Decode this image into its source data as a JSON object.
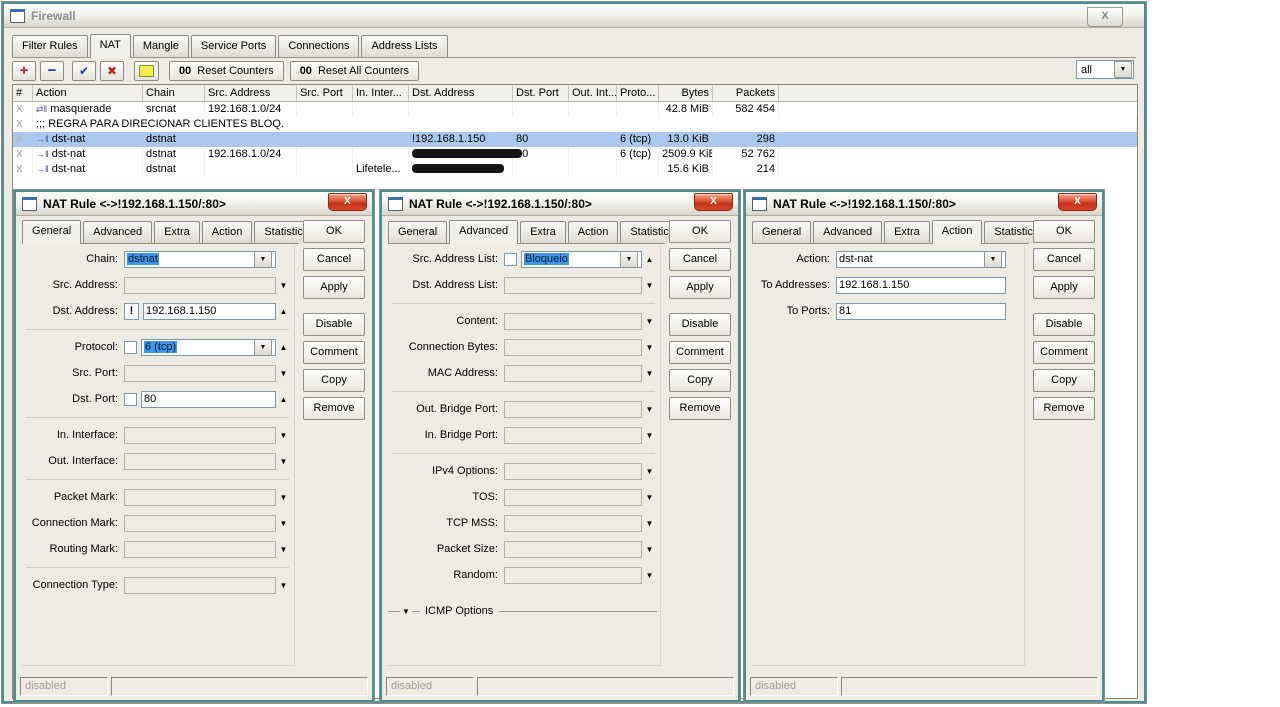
{
  "colors": {
    "selection_bg": "#3e95e5",
    "selected_row_bg": "#aac8ee",
    "frame_teal": "#4a8f8d",
    "close_button_red": "#d8472b"
  },
  "window": {
    "title": "Firewall",
    "close_glyph": "X",
    "tabs": [
      {
        "label": "Filter Rules"
      },
      {
        "label": "NAT"
      },
      {
        "label": "Mangle"
      },
      {
        "label": "Service Ports"
      },
      {
        "label": "Connections"
      },
      {
        "label": "Address Lists"
      }
    ],
    "active_tab": "NAT",
    "toolbar": {
      "icons": {
        "add": "+",
        "remove": "−",
        "enable": "✔",
        "disable": "✖",
        "comment": "note"
      },
      "reset_counters_prefix": "00",
      "reset_counters_label": "Reset Counters",
      "reset_all_counters_prefix": "00",
      "reset_all_counters_label": "Reset All Counters",
      "filter_value": "all"
    },
    "table": {
      "columns": [
        "#",
        "Action",
        "Chain",
        "Src. Address",
        "Src. Port",
        "In. Inter...",
        "Dst. Address",
        "Dst. Port",
        "Out. Int...",
        "Proto...",
        "Bytes",
        "Packets"
      ],
      "rows": [
        {
          "flag": "X",
          "action": "masquerade",
          "chain": "srcnat",
          "src_address": "192.168.1.0/24",
          "bytes": "42.8 MiB",
          "packets": "582 454"
        },
        {
          "flag": "X",
          "comment": ";;; REGRA PARA DIRECIONAR CLIENTES BLOQ."
        },
        {
          "flag": "X",
          "action": "dst-nat",
          "chain": "dstnat",
          "dst_address": "!192.168.1.150",
          "dst_port": "80",
          "protocol": "6 (tcp)",
          "bytes": "13.0 KiB",
          "packets": "298",
          "state": "selected"
        },
        {
          "flag": "X",
          "action": "dst-nat",
          "chain": "dstnat",
          "src_address": "192.168.1.0/24",
          "dst_address": "[redacted]",
          "dst_port": "80",
          "protocol": "6 (tcp)",
          "bytes": "2509.9 KiB",
          "packets": "52 762"
        },
        {
          "flag": "X",
          "action": "dst-nat",
          "chain": "dstnat",
          "in_interface": "Lifetele...",
          "dst_address": "[redacted]",
          "bytes": "15.6 KiB",
          "packets": "214"
        }
      ]
    }
  },
  "dialogs": [
    {
      "title": "NAT Rule <->!192.168.1.150/:80>",
      "tabs": [
        "General",
        "Advanced",
        "Extra",
        "Action",
        "Statistics"
      ],
      "active_tab": "General",
      "buttons": [
        "OK",
        "Cancel",
        "Apply",
        "Disable",
        "Comment",
        "Copy",
        "Remove"
      ],
      "status": "disabled",
      "fields": {
        "chain": {
          "label": "Chain:",
          "value": "dstnat"
        },
        "src_address": {
          "label": "Src. Address:",
          "value": ""
        },
        "dst_address": {
          "label": "Dst. Address:",
          "not_prefix": "!",
          "value": "192.168.1.150"
        },
        "protocol": {
          "label": "Protocol:",
          "value": "6 (tcp)"
        },
        "src_port": {
          "label": "Src. Port:",
          "value": ""
        },
        "dst_port": {
          "label": "Dst. Port:",
          "value": "80"
        },
        "in_interface": {
          "label": "In. Interface:",
          "value": ""
        },
        "out_interface": {
          "label": "Out. Interface:",
          "value": ""
        },
        "packet_mark": {
          "label": "Packet Mark:",
          "value": ""
        },
        "connection_mark": {
          "label": "Connection Mark:",
          "value": ""
        },
        "routing_mark": {
          "label": "Routing Mark:",
          "value": ""
        },
        "connection_type": {
          "label": "Connection Type:",
          "value": ""
        }
      }
    },
    {
      "title": "NAT Rule <->!192.168.1.150/:80>",
      "tabs": [
        "General",
        "Advanced",
        "Extra",
        "Action",
        "Statistics"
      ],
      "active_tab": "Advanced",
      "buttons": [
        "OK",
        "Cancel",
        "Apply",
        "Disable",
        "Comment",
        "Copy",
        "Remove"
      ],
      "status": "disabled",
      "fields": {
        "src_address_list": {
          "label": "Src. Address List:",
          "value": "Bloqueio"
        },
        "dst_address_list": {
          "label": "Dst. Address List:",
          "value": ""
        },
        "content": {
          "label": "Content:",
          "value": ""
        },
        "connection_bytes": {
          "label": "Connection Bytes:",
          "value": ""
        },
        "mac_address": {
          "label": "MAC Address:",
          "value": ""
        },
        "out_bridge_port": {
          "label": "Out. Bridge Port:",
          "value": ""
        },
        "in_bridge_port": {
          "label": "In. Bridge Port:",
          "value": ""
        },
        "ipv4_options": {
          "label": "IPv4 Options:",
          "value": ""
        },
        "tos": {
          "label": "TOS:",
          "value": ""
        },
        "tcp_mss": {
          "label": "TCP MSS:",
          "value": ""
        },
        "packet_size": {
          "label": "Packet Size:",
          "value": ""
        },
        "random": {
          "label": "Random:",
          "value": ""
        },
        "icmp_options": {
          "label": "ICMP Options"
        }
      }
    },
    {
      "title": "NAT Rule <->!192.168.1.150/:80>",
      "tabs": [
        "General",
        "Advanced",
        "Extra",
        "Action",
        "Statistics"
      ],
      "active_tab": "Action",
      "buttons": [
        "OK",
        "Cancel",
        "Apply",
        "Disable",
        "Comment",
        "Copy",
        "Remove"
      ],
      "status": "disabled",
      "fields": {
        "action": {
          "label": "Action:",
          "value": "dst-nat"
        },
        "to_addresses": {
          "label": "To Addresses:",
          "value": "192.168.1.150"
        },
        "to_ports": {
          "label": "To Ports:",
          "value": "81"
        }
      }
    }
  ]
}
